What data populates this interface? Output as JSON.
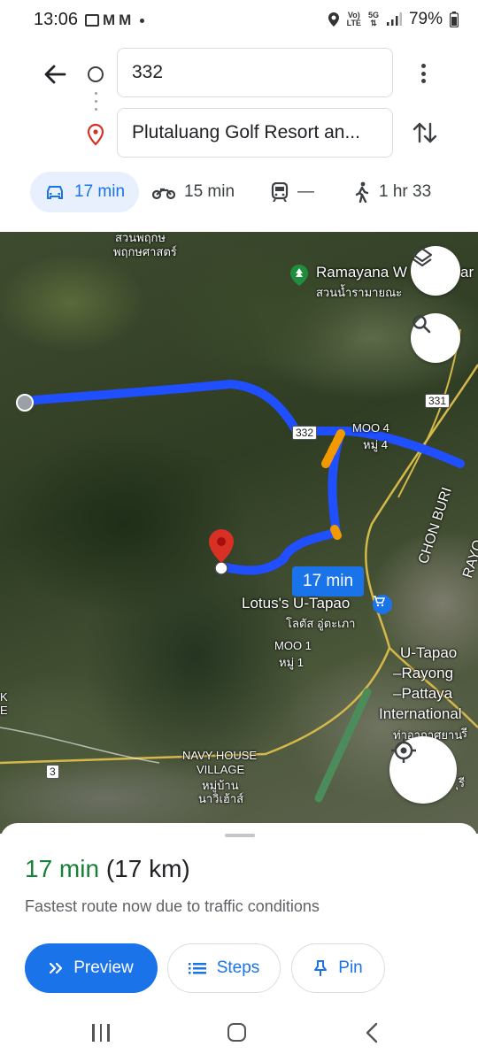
{
  "status": {
    "time": "13:06",
    "battery": "79%",
    "network_top": "Vo)",
    "network_bottom": "LTE",
    "gen_top": "5G",
    "gen_bottom": "⇅"
  },
  "directions": {
    "from": "332",
    "to": "Plutaluang Golf Resort an...",
    "modes": [
      {
        "icon": "car-icon",
        "label": "17 min",
        "active": true
      },
      {
        "icon": "motorcycle-icon",
        "label": "15 min",
        "active": false
      },
      {
        "icon": "transit-icon",
        "label": "—",
        "active": false
      },
      {
        "icon": "walk-icon",
        "label": "1 hr 33",
        "active": false
      }
    ]
  },
  "map": {
    "route_label": "17 min",
    "labels": {
      "top_cut": "สวนพฤกษ",
      "top_thai": "พฤกษศาสตร์",
      "ramayana": "Ramayana W",
      "ramayana_tail": "ar",
      "ramayana_thai": "สวนน้ำรามายณะ",
      "moo4": "MOO 4",
      "moo4_thai": "หมู่ 4",
      "chon_buri": "CHON BURI",
      "rayong_cut": "RAYO",
      "lotus": "Lotus's U-Tapao",
      "lotus_thai": "โลตัส อู่ตะเภา",
      "moo1": "MOO 1",
      "moo1_thai": "หมู่ 1",
      "airport_1": "U-Tapao",
      "airport_2": "–Rayong",
      "airport_3": "–Pattaya",
      "airport_4": "International",
      "airport_thai": "ท่าอากาศยาน",
      "navy_1": "NAVY HOUSE",
      "navy_2": "VILLAGE",
      "navy_thai_1": "หมู่บ้าน",
      "navy_thai_2": "นาวิเฮ้าส์",
      "left_cut_1": "K",
      "left_cut_2": "E",
      "right_cut": "รี",
      "right_cut_2": "ุรี"
    },
    "shields": {
      "s331": "331",
      "s332": "332",
      "s3": "3"
    }
  },
  "sheet": {
    "duration": "17 min",
    "distance": "(17 km)",
    "note": "Fastest route now due to traffic conditions",
    "preview_label": "Preview",
    "steps_label": "Steps",
    "pin_label": "Pin"
  },
  "colors": {
    "accent": "#1a73e8",
    "duration_green": "#188038",
    "route_blue": "#1f4fff",
    "traffic_orange": "#f29900",
    "pin_red": "#d93025"
  }
}
